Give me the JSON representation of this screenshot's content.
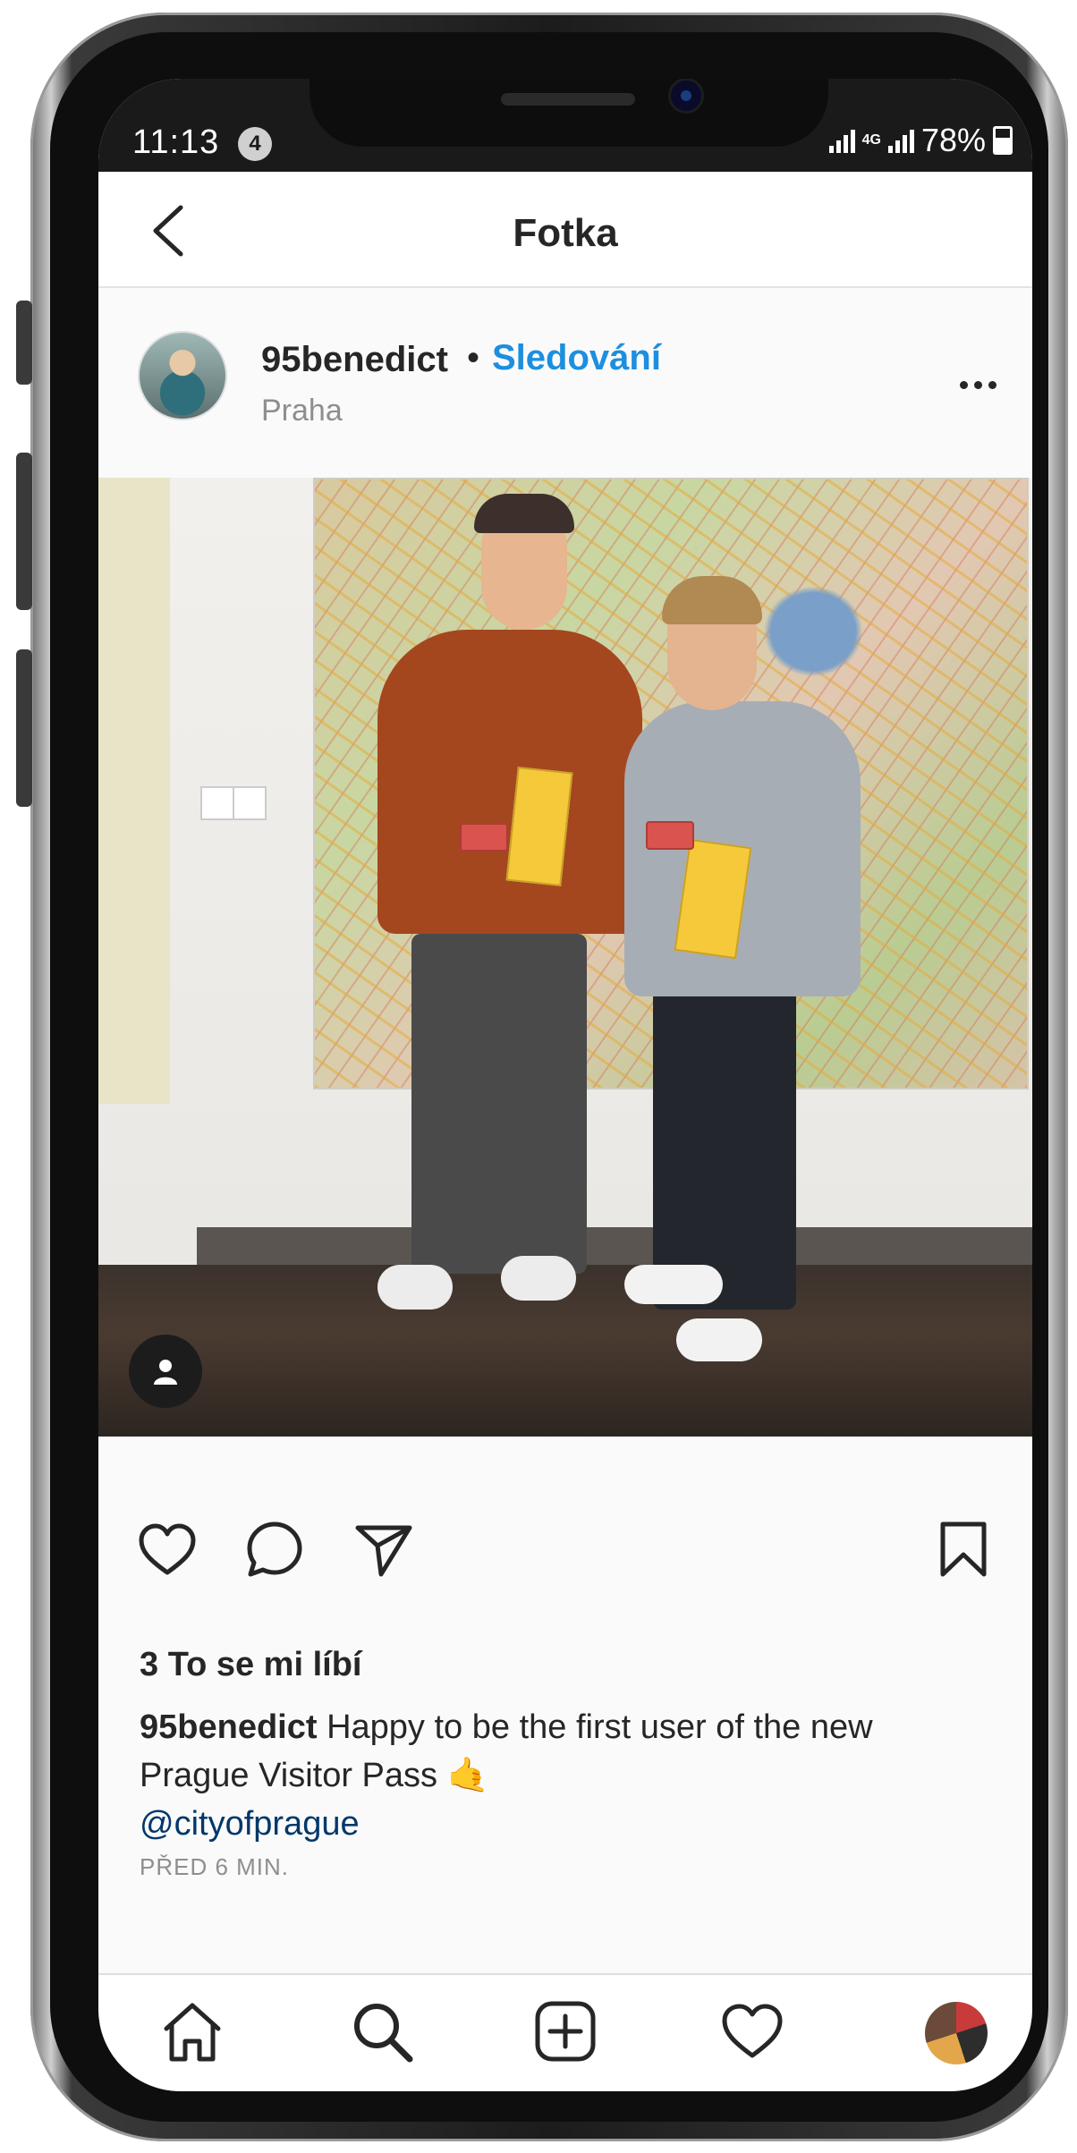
{
  "status_bar": {
    "time": "11:13",
    "notification_count": "4",
    "network": "4G",
    "battery": "78%"
  },
  "nav": {
    "title": "Fotka"
  },
  "post": {
    "username": "95benedict",
    "separator": "•",
    "follow_label": "Sledování",
    "location": "Praha",
    "likes": "3 To se mi líbí",
    "caption_user": "95benedict",
    "caption_text": " Happy to be the first user of the new Prague Visitor Pass ",
    "caption_emoji": "🤙",
    "mention": "@cityofprague",
    "timestamp": "PŘED 6 MIN."
  },
  "icons": {
    "back": "chevron-left-icon",
    "more": "more-horizontal-icon",
    "user_tag": "person-icon",
    "like": "heart-icon",
    "comment": "comment-icon",
    "share": "send-icon",
    "save": "bookmark-icon",
    "home": "home-icon",
    "search": "search-icon",
    "add": "plus-square-icon",
    "activity": "heart-icon"
  },
  "colors": {
    "link": "#1c8fe0",
    "mention": "#00376b",
    "muted": "#8e8e8e",
    "text": "#262626"
  }
}
